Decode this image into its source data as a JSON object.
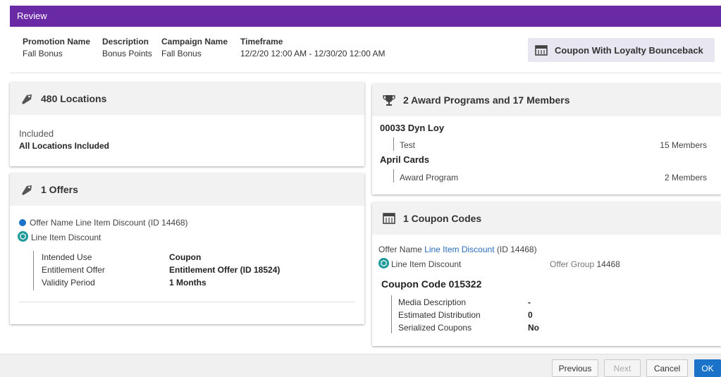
{
  "title": "Review",
  "summary": {
    "promotion_name_label": "Promotion Name",
    "promotion_name": "Fall Bonus",
    "description_label": "Description",
    "description": "Bonus Points",
    "campaign_name_label": "Campaign Name",
    "campaign_name": "Fall Bonus",
    "timeframe_label": "Timeframe",
    "timeframe": "12/2/20 12:00 AM - 12/30/20 12:00 AM",
    "type": "Coupon With Loyalty Bounceback"
  },
  "locations": {
    "heading": "480 Locations",
    "status": "Included",
    "detail": "All Locations Included"
  },
  "offers": {
    "heading": "1 Offers",
    "offer_line": "Offer Name Line Item Discount (ID 14468)",
    "offer_type": "Line Item Discount",
    "rows": [
      {
        "label": "Intended Use",
        "value": "Coupon"
      },
      {
        "label": "Entitlement Offer",
        "value": "Entitlement Offer (ID 18524)"
      },
      {
        "label": "Validity Period",
        "value": "1 Months"
      }
    ]
  },
  "awards": {
    "heading": "2 Award Programs and 17 Members",
    "programs": [
      {
        "name": "00033 Dyn Loy",
        "sub": "Test",
        "members": "15 Members"
      },
      {
        "name": "April Cards",
        "sub": "Award Program",
        "members": "2 Members"
      }
    ]
  },
  "coupons": {
    "heading": "1 Coupon Codes",
    "offer_prefix": "Offer Name",
    "offer_link": "Line Item Discount",
    "offer_suffix": "(ID 14468)",
    "offer_type": "Line Item Discount",
    "offer_group_label": "Offer Group",
    "offer_group": "14468",
    "code_title": "Coupon Code 015322",
    "rows": [
      {
        "label": "Media Description",
        "value": "-"
      },
      {
        "label": "Estimated Distribution",
        "value": "0"
      },
      {
        "label": "Serialized Coupons",
        "value": "No"
      }
    ]
  },
  "buttons": {
    "previous": "Previous",
    "next": "Next",
    "cancel": "Cancel",
    "ok": "OK"
  },
  "colors": {
    "header": "#6b2aa5",
    "primary": "#1a73c8",
    "teal": "#1f9a9a",
    "dot": "#1a73c8"
  }
}
